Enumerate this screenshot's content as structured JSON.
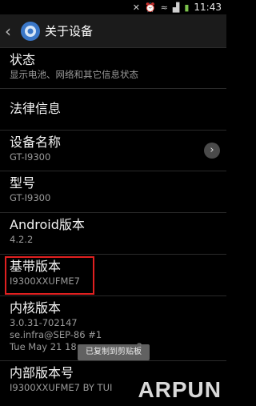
{
  "statusbar": {
    "icons": [
      "mute-icon",
      "alarm-icon",
      "wifi-icon",
      "signal-icon",
      "battery-icon"
    ],
    "time": "11:43"
  },
  "actionbar": {
    "title": "关于设备"
  },
  "items": [
    {
      "title": "状态",
      "subtitle": "显示电池、网络和其它信息状态"
    },
    {
      "title": "法律信息",
      "subtitle": ""
    },
    {
      "title": "设备名称",
      "subtitle": "GT-I9300"
    },
    {
      "title": "型号",
      "subtitle": "GT-I9300"
    },
    {
      "title": "Android版本",
      "subtitle": "4.2.2"
    },
    {
      "title": "基带版本",
      "subtitle": "I9300XXUFME7"
    },
    {
      "title": "内核版本",
      "subtitle_lines": [
        "3.0.31-702147",
        "se.infra@SEP-86 #1",
        "Tue May 21 18"
      ],
      "subtitle_tail": "3"
    },
    {
      "title": "内部版本号",
      "subtitle": "I9300XXUFME7 BY TUI"
    }
  ],
  "toast": "已复制到剪贴板",
  "watermark": "ARPUN",
  "colors": {
    "highlight": "#e02020"
  }
}
